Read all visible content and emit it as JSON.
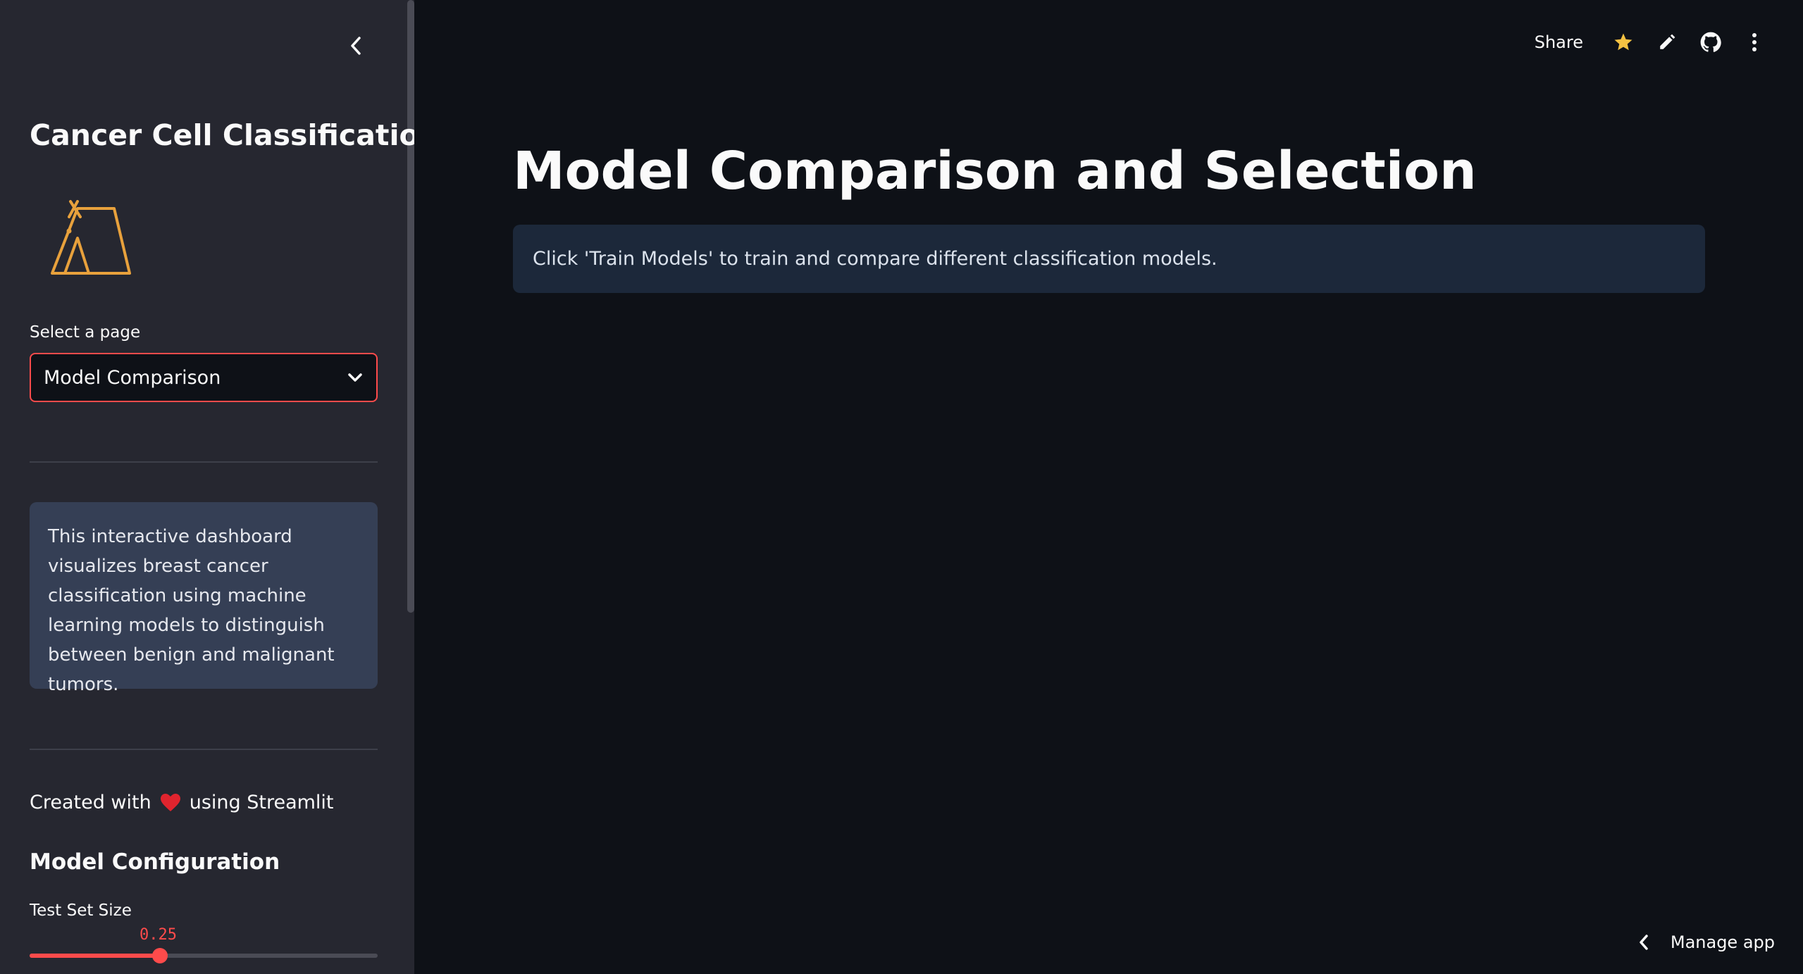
{
  "sidebar": {
    "title": "Cancer Cell Classification",
    "select_label": "Select a page",
    "select_value": "Model Comparison",
    "info_text": "This interactive dashboard visualizes breast cancer classification using machine learning models to distinguish between benign and malignant tumors.",
    "created_prefix": "Created with",
    "created_suffix": "using Streamlit",
    "config_title": "Model Configuration",
    "slider_label": "Test Set Size",
    "slider_value": "0.25",
    "slider_fraction": 0.375
  },
  "header": {
    "share_label": "Share",
    "icons": [
      "star-icon",
      "pencil-icon",
      "github-icon",
      "more-vertical-icon"
    ]
  },
  "main": {
    "title": "Model Comparison and Selection",
    "info_message": "Click 'Train Models' to train and compare different classification models."
  },
  "footer": {
    "manage_label": "Manage app"
  },
  "colors": {
    "accent": "#ff4b4b",
    "background": "#0e1117",
    "sidebar": "#262730",
    "star": "#f5c242",
    "logo": "#e8a13c"
  }
}
